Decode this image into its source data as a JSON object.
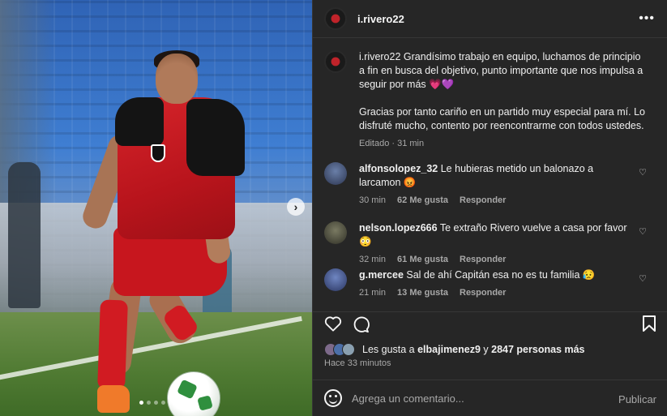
{
  "post": {
    "username": "i.rivero22",
    "more_icon": "ellipsis-icon",
    "caption": {
      "username": "i.rivero22",
      "text1": "Grandísimo trabajo en equipo, luchamos de principio a fin en busca del objetivo, punto importante que nos impulsa a seguir por más 💗💜",
      "text2": "Gracias por tanto cariño en un partido muy especial para mí. Lo disfruté mucho, contento por reencontrarme con todos ustedes.",
      "meta": "Editado · 31 min"
    },
    "media": {
      "image_desc": "photo-soccer-player",
      "next_icon": "›",
      "dots": 5,
      "active_dot": 0
    }
  },
  "comments": [
    {
      "user": "alfonsolopez_32",
      "text": "Le hubieras metido un balonazo a larcamon 😡",
      "time": "30 min",
      "likes": "62 Me gusta",
      "reply": "Responder",
      "avatar_color": "#3b4a6b"
    },
    {
      "user": "nelson.lopez666",
      "text": "Te extraño Rivero vuelve a casa por favor😳",
      "time": "32 min",
      "likes": "61 Me gusta",
      "reply": "Responder",
      "avatar_color": "#5a5a4a"
    },
    {
      "user": "g.mercee",
      "text": "Sal de ahí Capitán esa no es tu familia 😥",
      "time": "21 min",
      "likes": "13 Me gusta",
      "reply": "Responder",
      "avatar_color": "#4a5c8a"
    }
  ],
  "actions": {
    "like_icon": "heart-icon",
    "comment_icon": "comment-icon",
    "save_icon": "bookmark-icon"
  },
  "likes": {
    "prefix": "Les gusta a ",
    "first_user": "elbajimenez9",
    "middle": " y ",
    "others": "2847 personas más"
  },
  "time_ago": "Hace 33 minutos",
  "composer": {
    "placeholder": "Agrega un comentario...",
    "post_label": "Publicar"
  }
}
